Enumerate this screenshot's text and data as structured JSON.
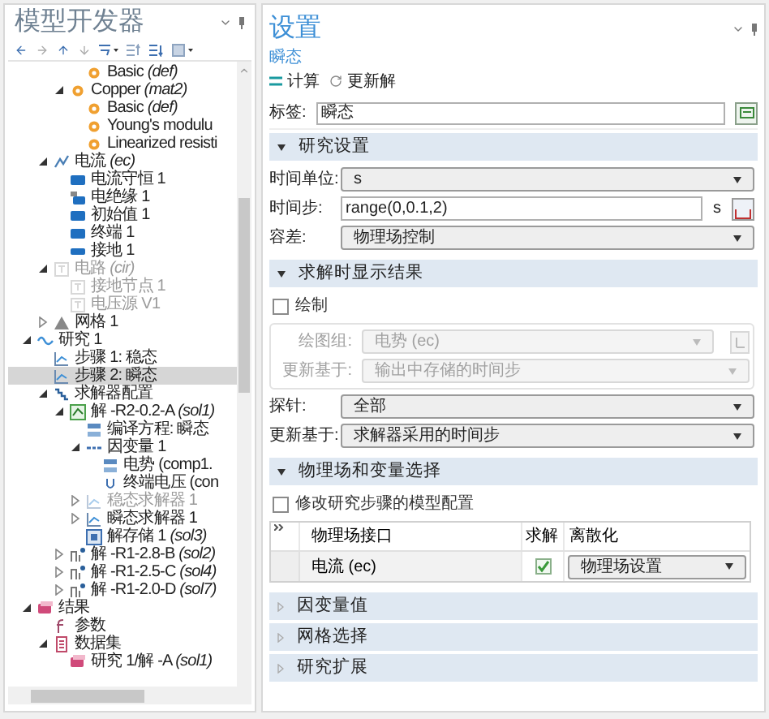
{
  "model_builder": {
    "title": "模型开发器",
    "tree": [
      {
        "children": [
          {
            "children": [
              {
                "children": [
                  {
                    "label": "Basic *(def)*",
                    "kind": "material",
                    "selected": false,
                    "disabled": false
                  }
                ]
              },
              {
                "label": "Copper *(mat2)*",
                "kind": "material",
                "expanded": true,
                "selected": false,
                "disabled": false,
                "children": [
                  {
                    "label": "Basic *(def)*",
                    "kind": "material",
                    "selected": false,
                    "disabled": false
                  },
                  {
                    "label": "Young's modulu",
                    "kind": "material",
                    "selected": false,
                    "disabled": false
                  },
                  {
                    "label": "Linearized resisti",
                    "kind": "material",
                    "selected": false,
                    "disabled": false
                  }
                ]
              }
            ]
          },
          {
            "label": "电流 *(ec)*",
            "kind": "physics",
            "expanded": true,
            "selected": false,
            "disabled": false,
            "children": [
              {
                "label": "电流守恒 1",
                "kind": "feature",
                "selected": false,
                "disabled": false
              },
              {
                "label": "电绝缘 1",
                "kind": "boundary",
                "selected": false,
                "disabled": false
              },
              {
                "label": "初始值 1",
                "kind": "feature",
                "selected": false,
                "disabled": false
              },
              {
                "label": "终端 1",
                "kind": "feature",
                "selected": false,
                "disabled": false
              },
              {
                "label": "接地 1",
                "kind": "ground",
                "selected": false,
                "disabled": false
              }
            ]
          },
          {
            "label": "电路 *(cir)*",
            "kind": "circuit",
            "expanded": true,
            "selected": false,
            "disabled": true,
            "children": [
              {
                "label": "接地节点 1",
                "kind": "circuit",
                "selected": false,
                "disabled": true
              },
              {
                "label": "电压源 V1",
                "kind": "circuit",
                "selected": false,
                "disabled": true
              }
            ]
          },
          {
            "label": "网格 1",
            "kind": "mesh",
            "expanded": false,
            "selected": false,
            "disabled": false
          }
        ]
      },
      {
        "label": "研究 1",
        "kind": "study",
        "expanded": true,
        "selected": false,
        "disabled": false,
        "children": [
          {
            "label": "步骤 1: 稳态",
            "kind": "step",
            "selected": false,
            "disabled": false
          },
          {
            "label": "步骤 2: 瞬态",
            "kind": "step",
            "selected": true,
            "disabled": false
          },
          {
            "label": "求解器配置",
            "kind": "solver",
            "expanded": true,
            "selected": false,
            "disabled": false,
            "children": [
              {
                "label": "解 -R2-0.2-A *(sol1)*",
                "kind": "solution",
                "expanded": true,
                "selected": false,
                "disabled": false,
                "children": [
                  {
                    "label": "编译方程: 瞬态",
                    "kind": "equation",
                    "selected": false,
                    "disabled": false
                  },
                  {
                    "label": "因变量 1",
                    "kind": "variables",
                    "expanded": true,
                    "selected": false,
                    "disabled": false,
                    "children": [
                      {
                        "label": "电势 (comp1.",
                        "kind": "equation",
                        "selected": false,
                        "disabled": false
                      },
                      {
                        "label": "终端电压 (con",
                        "kind": "field",
                        "selected": false,
                        "disabled": false
                      }
                    ]
                  },
                  {
                    "label": "稳态求解器 1",
                    "kind": "step",
                    "expanded": false,
                    "selected": false,
                    "disabled": true
                  },
                  {
                    "label": "瞬态求解器 1",
                    "kind": "step",
                    "expanded": false,
                    "selected": false,
                    "disabled": false
                  },
                  {
                    "label": "解存储 1 *(sol3)*",
                    "kind": "store",
                    "selected": false,
                    "disabled": false
                  }
                ]
              },
              {
                "label": "解 -R1-2.8-B *(sol2)*",
                "kind": "branch",
                "expanded": false,
                "selected": false,
                "disabled": false
              },
              {
                "label": "解 -R1-2.5-C *(sol4)*",
                "kind": "branch",
                "expanded": false,
                "selected": false,
                "disabled": false
              },
              {
                "label": "解 -R1-2.0-D *(sol7)*",
                "kind": "branch",
                "expanded": false,
                "selected": false,
                "disabled": false
              }
            ]
          }
        ]
      },
      {
        "label": "结果",
        "kind": "results",
        "expanded": true,
        "selected": false,
        "disabled": false,
        "children": [
          {
            "label": "参数",
            "kind": "parameters",
            "selected": false,
            "disabled": false
          },
          {
            "label": "数据集",
            "kind": "dataset",
            "expanded": true,
            "selected": false,
            "disabled": false,
            "children": [
              {
                "label": "研究 1/解 -A *(sol1)*",
                "kind": "results",
                "selected": false,
                "disabled": false
              }
            ]
          }
        ]
      }
    ]
  },
  "settings": {
    "title": "设置",
    "subtitle": "瞬态",
    "actions": [
      {
        "kind": "compute",
        "label": "计算"
      },
      {
        "kind": "update",
        "label": "更新解"
      }
    ],
    "label_field": {
      "label": "标签:",
      "value": "瞬态"
    },
    "sections": [
      {
        "title": "研究设置",
        "expanded": true,
        "items": [
          {
            "kind": "select",
            "label": "时间单位:",
            "value": "s",
            "disabled": false
          },
          {
            "kind": "text",
            "label": "时间步:",
            "value": "range(0,0.1,2)",
            "unit": "s"
          },
          {
            "kind": "select",
            "label": "容差:",
            "value": "物理场控制",
            "disabled": false
          }
        ]
      },
      {
        "title": "求解时显示结果",
        "expanded": true,
        "items": [
          {
            "kind": "checkbox",
            "label": "绘制",
            "checked": false
          },
          {
            "kind": "group",
            "items": [
              {
                "kind": "select",
                "label": "绘图组:",
                "value": "电势 (ec)",
                "disabled": true,
                "button": true
              },
              {
                "kind": "select",
                "label": "更新基于:",
                "value": "输出中存储的时间步",
                "disabled": true
              }
            ]
          },
          {
            "kind": "select",
            "label": "探针:",
            "value": "全部",
            "disabled": false
          },
          {
            "kind": "select",
            "label": "更新基于:",
            "value": "求解器采用的时间步",
            "disabled": false
          }
        ]
      },
      {
        "title": "物理场和变量选择",
        "expanded": true,
        "items": [
          {
            "kind": "checkbox",
            "label": "修改研究步骤的模型配置",
            "checked": false
          },
          {
            "kind": "table",
            "columns": [
              "物理场接口",
              "求解",
              "离散化"
            ],
            "rows": [
              {
                "interface": "电流 (ec)",
                "solve": true,
                "discretization": "物理场设置"
              }
            ]
          }
        ]
      },
      {
        "title": "因变量值",
        "expanded": false
      },
      {
        "title": "网格选择",
        "expanded": false
      },
      {
        "title": "研究扩展",
        "expanded": false
      }
    ]
  }
}
